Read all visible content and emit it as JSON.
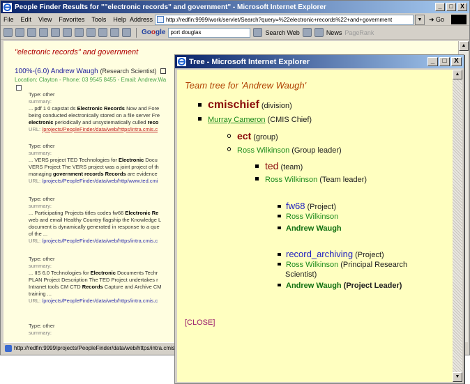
{
  "main_window": {
    "title": "People Finder Results for \"\"electronic records\" and government\" - Microsoft Internet Explorer",
    "controls": [
      "_",
      "□",
      "X"
    ],
    "menu": [
      "File",
      "Edit",
      "View",
      "Favorites",
      "Tools",
      "Help"
    ],
    "address_label": "Address",
    "address_value": "http://redfin:9999/work/servlet/Search?query=%22electronic+records%22+and+government",
    "go_label": "Go",
    "toolbar": {
      "google_search_value": "port douglas",
      "search_web_label": "Search Web",
      "news_label": "News",
      "page_rank_label": "PageRank"
    }
  },
  "results": {
    "query_title": "\"electronic records\" and government",
    "person": {
      "score": "100%-(6.0)",
      "name": "Andrew Waugh",
      "role": "(Research Scientist)",
      "location": "Location: Clayton - Phone: 03 9545 8455 - Email: Andrew.Wa"
    },
    "hits": [
      {
        "type": "Type: other",
        "summary": "summary:",
        "line1a": "... pdf 1 0 capstat ds ",
        "line1b": "Electronic Records",
        "line1c": " Now and Fore",
        "line2": "being conducted electronically stored on a file server Fre",
        "line3a": "electronic",
        "line3b": " periodically and unsystematically culled ",
        "line3c": "reco",
        "url_label": "URL: ",
        "url": "/projects/PeopleFinder/data/web/https/intra.cmis.c"
      },
      {
        "type": "Type: other",
        "summary": "summary:",
        "line1a": "... VERS project TED Technologies for ",
        "line1b": "Electronic",
        "line1c": " Docu",
        "line2": "VERS Project The VERS project was a joint project of th",
        "line3a": "managing ",
        "line3b": "government records Records",
        "line3c": " are evidence",
        "url_label": "URL: ",
        "url": "/projects/PeopleFinder/data/web/http/www.ted.cmi"
      },
      {
        "type": "Type: other",
        "summary": "summary:",
        "line1a": "... Participating Projects titles codes fw66 ",
        "line1b": "Electronic Re",
        "line1c": "",
        "line2": "web and email Healthy Country flagship the Knowledge L",
        "line3a": "document is dynamically generated in response to a que",
        "line3b": "",
        "line3c": "",
        "line4": "of the ...",
        "url_label": "URL: ",
        "url": "/projects/PeopleFinder/data/web/https/intra.cmis.c"
      },
      {
        "type": "Type: other",
        "summary": "summary:",
        "line1a": "... IIS 6.0 Technologies for ",
        "line1b": "Electronic",
        "line1c": " Documents Techr",
        "line2": "PLAN Project Description The TED Project undertakes r",
        "line3a": "Intranet tools CM CTD ",
        "line3b": "Records",
        "line3c": " Capture and Archive CM",
        "line4": "training ...",
        "url_label": "URL: ",
        "url": "/projects/PeopleFinder/data/web/https/intra.cmis.c"
      },
      {
        "type": "Type: other",
        "summary": "summary:"
      }
    ],
    "status_url": "http://redfin:9999/projects/PeopleFinder/data/web/https/intra.cmis.c"
  },
  "tree_window": {
    "title": "Tree - Microsoft Internet Explorer",
    "heading": "Team tree for 'Andrew Waugh'",
    "nodes": {
      "division_name": "cmischief",
      "division_type": "(division)",
      "chief_name": "Murray Cameron",
      "chief_role": "(CMIS Chief)",
      "group_name": "ect",
      "group_type": "(group)",
      "group_leader_name": "Ross Wilkinson",
      "group_leader_role": "(Group leader)",
      "team_name": "ted",
      "team_type": "(team)",
      "team_leader_name": "Ross Wilkinson",
      "team_leader_role": "(Team leader)",
      "project1_name": "fw68",
      "project1_type": "(Project)",
      "project1_member1": "Ross Wilkinson",
      "project1_member2": "Andrew Waugh",
      "project2_name": "record_archiving",
      "project2_type": "(Project)",
      "project2_member1": "Ross Wilkinson",
      "project2_member1_role_a": "(Principal Research",
      "project2_member1_role_b": "Scientist)",
      "project2_member2": "Andrew Waugh",
      "project2_member2_role": "(Project Leader)"
    },
    "close_label": "[CLOSE]"
  }
}
